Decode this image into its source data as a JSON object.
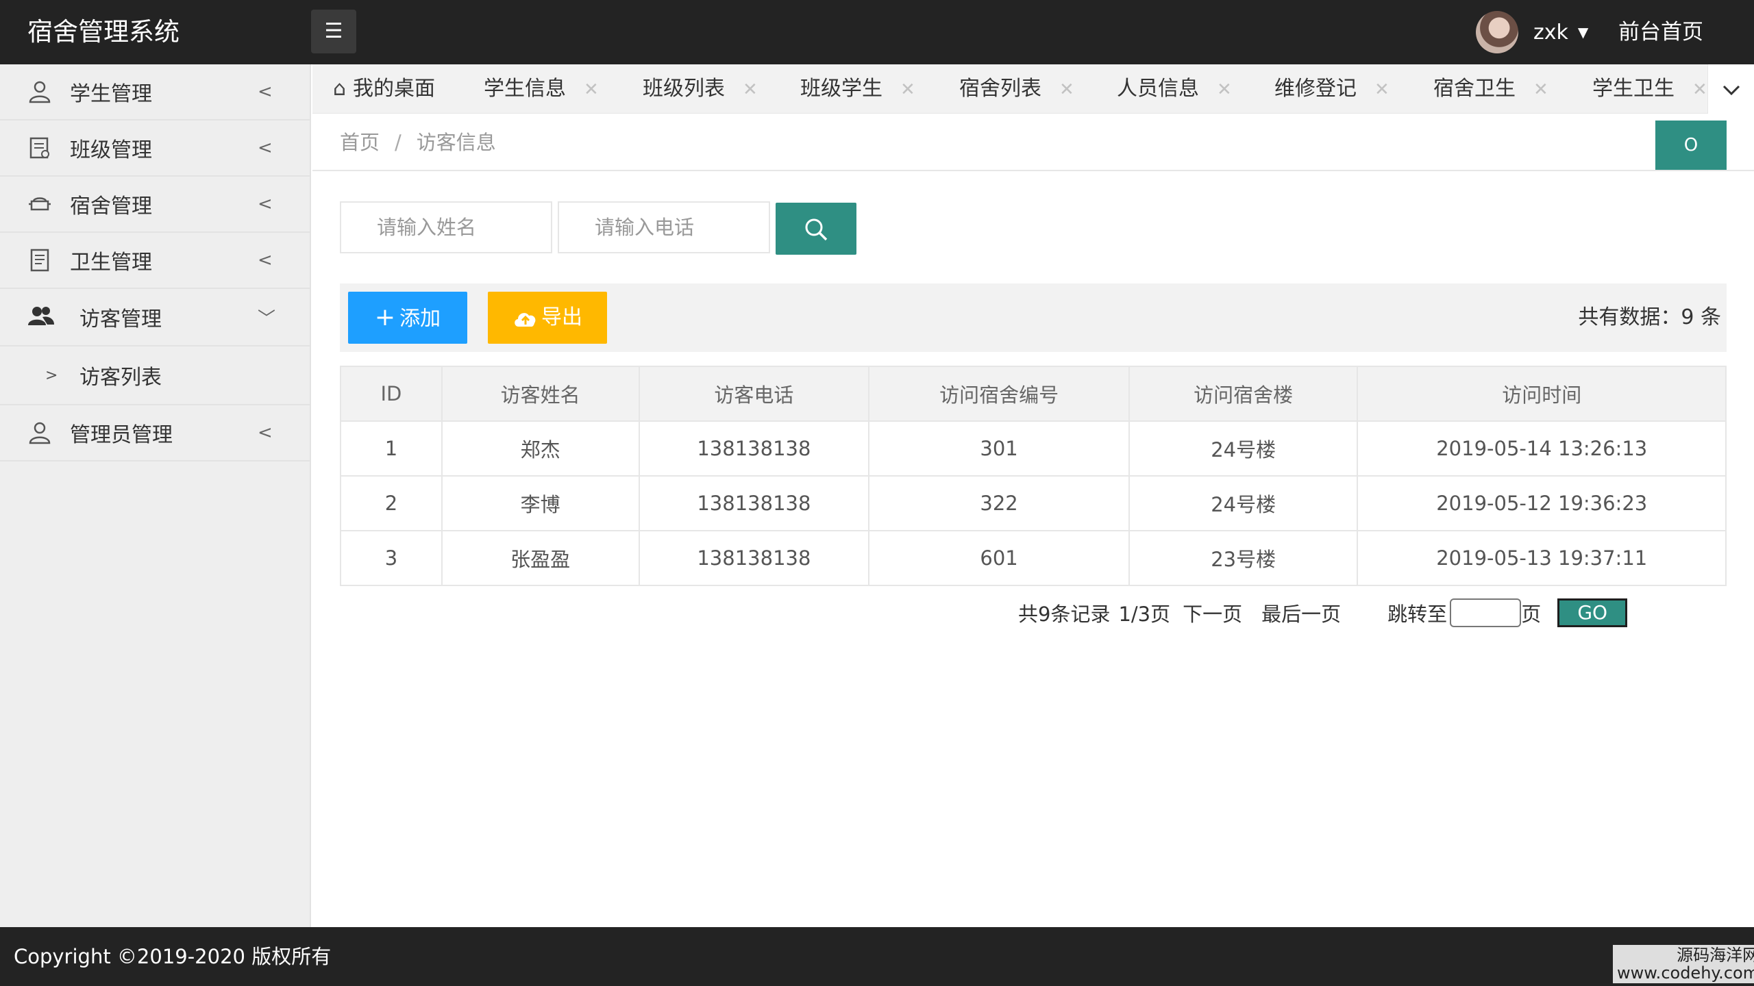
{
  "header": {
    "app_title": "宿舍管理系统",
    "menu_icon": "menu-icon",
    "user_name": "zxk",
    "front_link": "前台首页"
  },
  "sidebar": {
    "items": [
      {
        "label": "学生管理",
        "icon": "user-icon",
        "arrow": "<"
      },
      {
        "label": "班级管理",
        "icon": "document-icon",
        "arrow": "<"
      },
      {
        "label": "宿舍管理",
        "icon": "sofa-icon",
        "arrow": "<"
      },
      {
        "label": "卫生管理",
        "icon": "list-icon",
        "arrow": "<"
      },
      {
        "label": "访客管理",
        "icon": "users-icon",
        "arrow": "﹀"
      },
      {
        "label": "管理员管理",
        "icon": "user-icon",
        "arrow": "<"
      }
    ],
    "sub_items": [
      {
        "label": "访客列表",
        "arrow": ">"
      }
    ]
  },
  "tabs": [
    {
      "label": "我的桌面"
    },
    {
      "label": "学生信息"
    },
    {
      "label": "班级列表"
    },
    {
      "label": "班级学生"
    },
    {
      "label": "宿舍列表"
    },
    {
      "label": "人员信息"
    },
    {
      "label": "维修登记"
    },
    {
      "label": "宿舍卫生"
    },
    {
      "label": "学生卫生"
    }
  ],
  "tab_close_glyph": "✕",
  "breadcrumb": {
    "home": "首页",
    "separator": "/",
    "current": "访客信息"
  },
  "refresh_icon": "Ο",
  "search": {
    "name_placeholder": "请输入姓名",
    "phone_placeholder": "请输入电话"
  },
  "toolbar": {
    "add_label": "添加",
    "export_label": "导出",
    "total_text": "共有数据：9 条"
  },
  "table": {
    "columns": [
      "ID",
      "访客姓名",
      "访客电话",
      "访问宿舍编号",
      "访问宿舍楼",
      "访问时间"
    ],
    "rows": [
      [
        "1",
        "郑杰",
        "138138138",
        "301",
        "24号楼",
        "2019-05-14 13:26:13"
      ],
      [
        "2",
        "李博",
        "138138138",
        "322",
        "24号楼",
        "2019-05-12 19:36:23"
      ],
      [
        "3",
        "张盈盈",
        "138138138",
        "601",
        "23号楼",
        "2019-05-13 19:37:11"
      ]
    ]
  },
  "pager": {
    "records": "共9条记录",
    "page": "1/3页",
    "next": "下一页",
    "last": "最后一页",
    "jump_to": "跳转至",
    "page_unit": "页",
    "go": "GO"
  },
  "footer": {
    "copyright": "Copyright ©2019-2020 版权所有",
    "watermark_line1": "源码海洋网",
    "watermark_line2": "www.codehy.com"
  },
  "colors": {
    "header_bg": "#232323",
    "accent_green": "#2f8f83",
    "add_blue": "#1e9fff",
    "export_orange": "#ffb800"
  }
}
